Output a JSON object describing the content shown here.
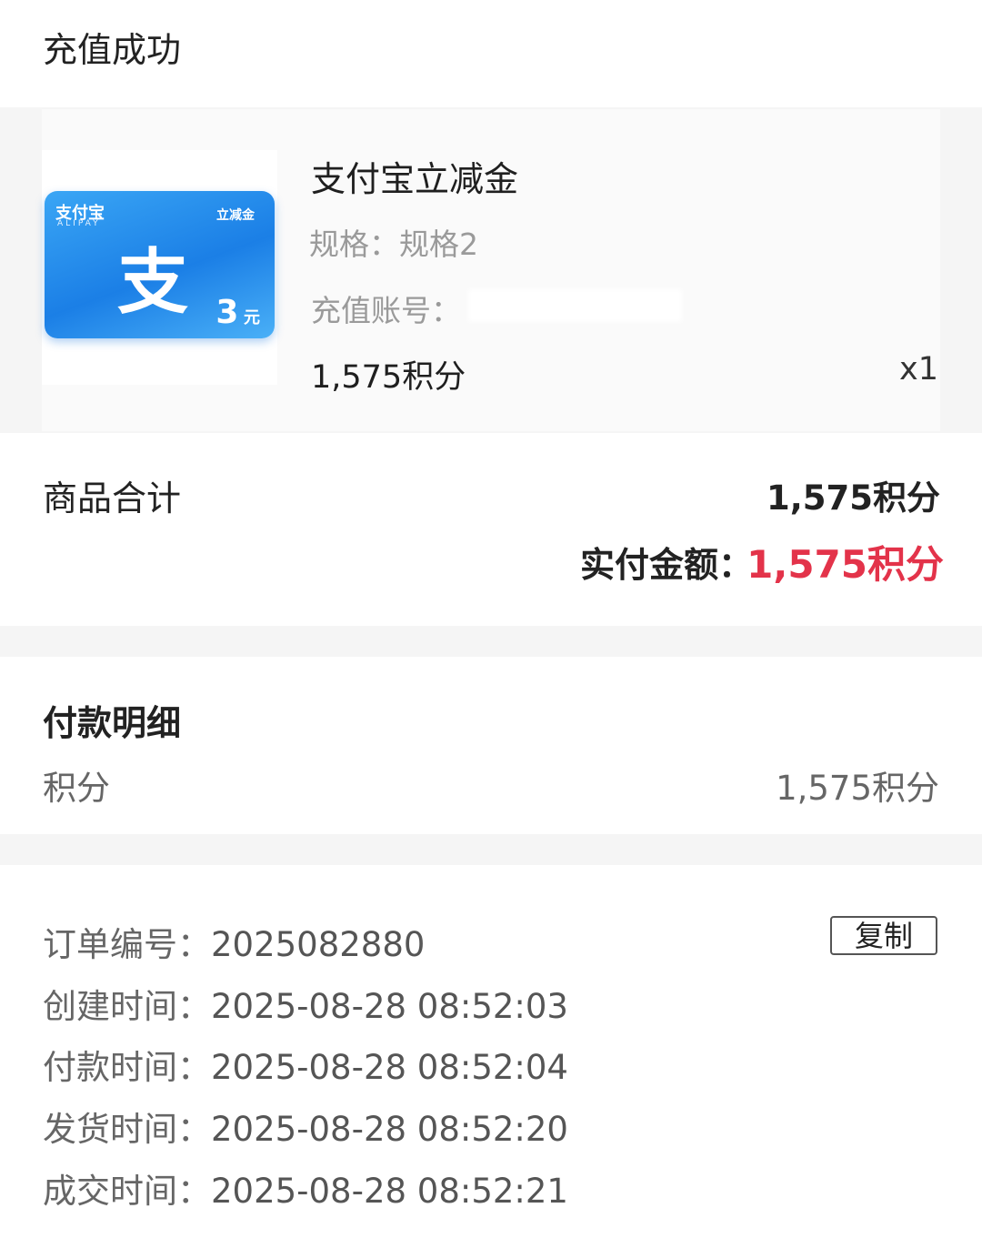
{
  "header": {
    "status": "充值成功"
  },
  "product": {
    "card": {
      "brand_cn": "支付宝",
      "brand_en": "ALIPAY",
      "tag": "立减金",
      "glyph": "支",
      "amount": "3",
      "unit": "元"
    },
    "name": "支付宝立减金",
    "spec": "规格：规格2",
    "account_label": "充值账号：",
    "points": "1,575积分",
    "quantity": "x1"
  },
  "summary": {
    "subtotal_label": "商品合计",
    "subtotal_value": "1,575积分",
    "paid_label": "实付金额：",
    "paid_value": "1,575积分",
    "colors": {
      "paid": "#e3334a"
    }
  },
  "payment_detail": {
    "title": "付款明细",
    "method_label": "积分",
    "method_value": "1,575积分"
  },
  "order_info": {
    "copy_label": "复制",
    "rows": [
      {
        "label": "订单编号：",
        "value": "2025082880"
      },
      {
        "label": "创建时间：",
        "value": "2025-08-28 08:52:03"
      },
      {
        "label": "付款时间：",
        "value": "2025-08-28 08:52:04"
      },
      {
        "label": "发货时间：",
        "value": "2025-08-28 08:52:20"
      },
      {
        "label": "成交时间：",
        "value": "2025-08-28 08:52:21"
      }
    ]
  }
}
